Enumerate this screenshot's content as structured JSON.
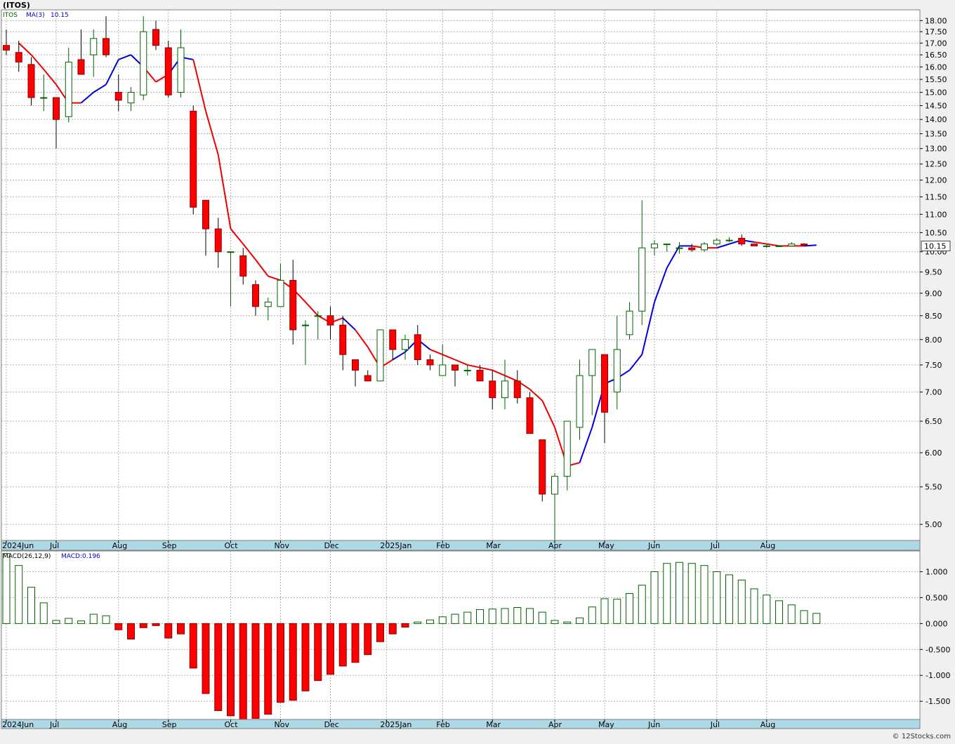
{
  "header": {
    "title": "(ITOS)",
    "legend_symbol": "ITOS",
    "legend_ma_label": "MA(3)",
    "legend_ma_value": "10.15"
  },
  "macd_header": {
    "label": "MACD(26,12,9)",
    "value_label": "MACD:0.196"
  },
  "footer": {
    "credit": "© 12Stocks.com"
  },
  "colors": {
    "up_body": "#ffffff",
    "up_border": "#006400",
    "down_body": "#ff0000",
    "down_border": "#8b0000",
    "ma_up": "#0000dd",
    "ma_down": "#ee0000",
    "grid": "#b0b0b0",
    "plot_bg": "#ffffff",
    "axis_band": "#add8e6"
  },
  "chart_data": [
    {
      "type": "candlestick",
      "title": "(ITOS)",
      "price_label": "10.15",
      "ylim": [
        4.8,
        18.5
      ],
      "log_scale": true,
      "grid": true,
      "y_ticks": [
        "18.00",
        "17.50",
        "17.00",
        "16.50",
        "16.00",
        "15.50",
        "15.00",
        "14.50",
        "14.00",
        "13.50",
        "13.00",
        "12.50",
        "12.00",
        "11.50",
        "11.00",
        "10.50",
        "10.00",
        "9.50",
        "9.00",
        "8.50",
        "8.00",
        "7.50",
        "7.00",
        "6.50",
        "6.00",
        "5.50",
        "5.00"
      ],
      "x_labels": [
        {
          "label": "2024Jun",
          "week": 0
        },
        {
          "label": "Jul",
          "week": 4
        },
        {
          "label": "Aug",
          "week": 9
        },
        {
          "label": "Sep",
          "week": 13
        },
        {
          "label": "Oct",
          "week": 18
        },
        {
          "label": "Nov",
          "week": 22
        },
        {
          "label": "Dec",
          "week": 26
        },
        {
          "label": "2025Jan",
          "week": 30.5
        },
        {
          "label": "Feb",
          "week": 35
        },
        {
          "label": "Mar",
          "week": 39
        },
        {
          "label": "Apr",
          "week": 44
        },
        {
          "label": "May",
          "week": 48
        },
        {
          "label": "Jun",
          "week": 52
        },
        {
          "label": "Jul",
          "week": 57
        },
        {
          "label": "Aug",
          "week": 61
        }
      ],
      "candles": [
        {
          "o": 16.9,
          "h": 17.6,
          "l": 16.5,
          "c": 16.7
        },
        {
          "o": 16.6,
          "h": 17.1,
          "l": 15.8,
          "c": 16.2
        },
        {
          "o": 16.1,
          "h": 16.4,
          "l": 14.5,
          "c": 14.8
        },
        {
          "o": 14.8,
          "h": 15.7,
          "l": 14.3,
          "c": 14.8
        },
        {
          "o": 14.8,
          "h": 14.8,
          "l": 13.0,
          "c": 14.0
        },
        {
          "o": 14.1,
          "h": 16.8,
          "l": 13.9,
          "c": 16.2
        },
        {
          "o": 16.3,
          "h": 17.6,
          "l": 15.7,
          "c": 15.7
        },
        {
          "o": 16.5,
          "h": 17.6,
          "l": 15.6,
          "c": 17.2
        },
        {
          "o": 17.2,
          "h": 18.2,
          "l": 16.4,
          "c": 16.5
        },
        {
          "o": 15.0,
          "h": 15.7,
          "l": 14.3,
          "c": 14.7
        },
        {
          "o": 14.6,
          "h": 15.2,
          "l": 14.3,
          "c": 15.0
        },
        {
          "o": 14.9,
          "h": 18.2,
          "l": 14.7,
          "c": 17.5
        },
        {
          "o": 17.6,
          "h": 18.0,
          "l": 16.7,
          "c": 16.9
        },
        {
          "o": 16.8,
          "h": 17.1,
          "l": 14.8,
          "c": 14.9
        },
        {
          "o": 15.0,
          "h": 17.6,
          "l": 14.8,
          "c": 16.8
        },
        {
          "o": 14.3,
          "h": 14.5,
          "l": 11.0,
          "c": 11.2
        },
        {
          "o": 11.4,
          "h": 11.4,
          "l": 9.9,
          "c": 10.6
        },
        {
          "o": 10.6,
          "h": 10.9,
          "l": 9.6,
          "c": 10.0
        },
        {
          "o": 10.0,
          "h": 10.0,
          "l": 8.7,
          "c": 10.0
        },
        {
          "o": 9.9,
          "h": 10.1,
          "l": 9.2,
          "c": 9.4
        },
        {
          "o": 9.2,
          "h": 9.3,
          "l": 8.5,
          "c": 8.7
        },
        {
          "o": 8.7,
          "h": 8.9,
          "l": 8.4,
          "c": 8.8
        },
        {
          "o": 8.7,
          "h": 9.7,
          "l": 8.7,
          "c": 9.3
        },
        {
          "o": 9.3,
          "h": 9.8,
          "l": 7.9,
          "c": 8.2
        },
        {
          "o": 8.3,
          "h": 8.4,
          "l": 7.5,
          "c": 8.3
        },
        {
          "o": 8.5,
          "h": 8.6,
          "l": 8.0,
          "c": 8.5
        },
        {
          "o": 8.5,
          "h": 8.7,
          "l": 8.0,
          "c": 8.3
        },
        {
          "o": 8.3,
          "h": 8.5,
          "l": 7.4,
          "c": 7.7
        },
        {
          "o": 7.6,
          "h": 7.6,
          "l": 7.1,
          "c": 7.4
        },
        {
          "o": 7.3,
          "h": 7.4,
          "l": 7.2,
          "c": 7.2
        },
        {
          "o": 7.2,
          "h": 8.2,
          "l": 7.2,
          "c": 8.2
        },
        {
          "o": 8.2,
          "h": 8.2,
          "l": 7.6,
          "c": 7.8
        },
        {
          "o": 7.8,
          "h": 8.1,
          "l": 7.6,
          "c": 8.0
        },
        {
          "o": 8.1,
          "h": 8.3,
          "l": 7.5,
          "c": 7.6
        },
        {
          "o": 7.6,
          "h": 7.7,
          "l": 7.4,
          "c": 7.5
        },
        {
          "o": 7.3,
          "h": 7.9,
          "l": 7.3,
          "c": 7.5
        },
        {
          "o": 7.5,
          "h": 7.5,
          "l": 7.1,
          "c": 7.4
        },
        {
          "o": 7.4,
          "h": 7.5,
          "l": 7.3,
          "c": 7.4
        },
        {
          "o": 7.4,
          "h": 7.5,
          "l": 7.2,
          "c": 7.2
        },
        {
          "o": 7.2,
          "h": 7.4,
          "l": 6.7,
          "c": 6.9
        },
        {
          "o": 6.9,
          "h": 7.6,
          "l": 6.7,
          "c": 7.2
        },
        {
          "o": 7.2,
          "h": 7.4,
          "l": 6.8,
          "c": 6.9
        },
        {
          "o": 6.9,
          "h": 7.0,
          "l": 6.3,
          "c": 6.3
        },
        {
          "o": 6.2,
          "h": 6.2,
          "l": 5.3,
          "c": 5.4
        },
        {
          "o": 5.4,
          "h": 5.7,
          "l": 4.8,
          "c": 5.65
        },
        {
          "o": 5.65,
          "h": 6.5,
          "l": 5.45,
          "c": 6.5
        },
        {
          "o": 6.4,
          "h": 7.6,
          "l": 6.2,
          "c": 7.3
        },
        {
          "o": 7.3,
          "h": 7.8,
          "l": 6.6,
          "c": 7.8
        },
        {
          "o": 7.7,
          "h": 7.7,
          "l": 6.15,
          "c": 6.65
        },
        {
          "o": 7.0,
          "h": 8.5,
          "l": 6.7,
          "c": 7.8
        },
        {
          "o": 8.1,
          "h": 8.8,
          "l": 8.0,
          "c": 8.6
        },
        {
          "o": 8.6,
          "h": 11.4,
          "l": 8.3,
          "c": 10.1
        },
        {
          "o": 10.1,
          "h": 10.3,
          "l": 9.9,
          "c": 10.2
        },
        {
          "o": 10.2,
          "h": 10.2,
          "l": 10.0,
          "c": 10.2
        },
        {
          "o": 10.1,
          "h": 10.25,
          "l": 9.95,
          "c": 10.1
        },
        {
          "o": 10.1,
          "h": 10.2,
          "l": 10.0,
          "c": 10.05
        },
        {
          "o": 10.05,
          "h": 10.25,
          "l": 10.0,
          "c": 10.2
        },
        {
          "o": 10.2,
          "h": 10.35,
          "l": 10.15,
          "c": 10.3
        },
        {
          "o": 10.3,
          "h": 10.38,
          "l": 10.25,
          "c": 10.3
        },
        {
          "o": 10.35,
          "h": 10.45,
          "l": 10.15,
          "c": 10.2
        },
        {
          "o": 10.2,
          "h": 10.2,
          "l": 10.15,
          "c": 10.15
        },
        {
          "o": 10.15,
          "h": 10.2,
          "l": 10.1,
          "c": 10.15
        },
        {
          "o": 10.15,
          "h": 10.15,
          "l": 10.15,
          "c": 10.15
        },
        {
          "o": 10.15,
          "h": 10.25,
          "l": 10.15,
          "c": 10.2
        },
        {
          "o": 10.2,
          "h": 10.22,
          "l": 10.15,
          "c": 10.17
        }
      ],
      "ma3": [
        17.0,
        16.5,
        15.9,
        15.3,
        14.6,
        14.6,
        15.0,
        15.3,
        16.3,
        16.5,
        16.0,
        15.4,
        15.7,
        16.4,
        16.3,
        14.3,
        12.8,
        10.6,
        10.2,
        9.8,
        9.4,
        9.3,
        9.1,
        8.8,
        8.5,
        8.35,
        8.45,
        8.2,
        7.85,
        7.45,
        7.6,
        7.75,
        8.0,
        7.8,
        7.7,
        7.6,
        7.5,
        7.45,
        7.4,
        7.3,
        7.2,
        7.05,
        6.85,
        6.4,
        5.8,
        5.85,
        6.4,
        7.15,
        7.25,
        7.4,
        7.7,
        8.8,
        9.6,
        10.15,
        10.15,
        10.1,
        10.1,
        10.2,
        10.3,
        10.25,
        10.2,
        10.15,
        10.15,
        10.15,
        10.17
      ],
      "ma_color_up": [
        0,
        0,
        0,
        0,
        0,
        1,
        1,
        1,
        1,
        1,
        0,
        0,
        1,
        1,
        0,
        0,
        0,
        0,
        0,
        0,
        0,
        0,
        0,
        0,
        0,
        0,
        1,
        0,
        0,
        0,
        1,
        1,
        1,
        0,
        0,
        0,
        0,
        0,
        0,
        0,
        0,
        0,
        0,
        0,
        0,
        1,
        1,
        1,
        1,
        1,
        1,
        1,
        1,
        1,
        0,
        0,
        1,
        1,
        1,
        0,
        0,
        0,
        0,
        1,
        1
      ]
    },
    {
      "type": "bar",
      "title": "MACD(26,12,9)",
      "ylim": [
        -1.85,
        1.4
      ],
      "grid": true,
      "y_ticks": [
        "1.000",
        "0.500",
        "0.000",
        "-0.500",
        "-1.000",
        "-1.500"
      ],
      "x_labels": [
        {
          "label": "2024Jun",
          "week": 0
        },
        {
          "label": "Jul",
          "week": 4
        },
        {
          "label": "Aug",
          "week": 9
        },
        {
          "label": "Sep",
          "week": 13
        },
        {
          "label": "Oct",
          "week": 18
        },
        {
          "label": "Nov",
          "week": 22
        },
        {
          "label": "Dec",
          "week": 26
        },
        {
          "label": "2025Jan",
          "week": 30.5
        },
        {
          "label": "Feb",
          "week": 35
        },
        {
          "label": "Mar",
          "week": 39
        },
        {
          "label": "Apr",
          "week": 44
        },
        {
          "label": "May",
          "week": 48
        },
        {
          "label": "Jun",
          "week": 52
        },
        {
          "label": "Jul",
          "week": 57
        },
        {
          "label": "Aug",
          "week": 61
        }
      ],
      "values": [
        1.35,
        1.12,
        0.7,
        0.4,
        0.06,
        0.1,
        0.05,
        0.18,
        0.15,
        -0.12,
        -0.3,
        -0.08,
        -0.04,
        -0.28,
        -0.2,
        -0.86,
        -1.35,
        -1.68,
        -1.78,
        -1.85,
        -1.83,
        -1.75,
        -1.52,
        -1.48,
        -1.3,
        -1.1,
        -0.98,
        -0.82,
        -0.75,
        -0.6,
        -0.35,
        -0.2,
        -0.07,
        0.03,
        0.07,
        0.13,
        0.18,
        0.22,
        0.27,
        0.28,
        0.29,
        0.31,
        0.29,
        0.22,
        0.06,
        0.03,
        0.11,
        0.32,
        0.48,
        0.47,
        0.58,
        0.74,
        1.0,
        1.16,
        1.18,
        1.16,
        1.12,
        1.0,
        0.94,
        0.84,
        0.67,
        0.55,
        0.44,
        0.36,
        0.25,
        0.196
      ]
    }
  ]
}
